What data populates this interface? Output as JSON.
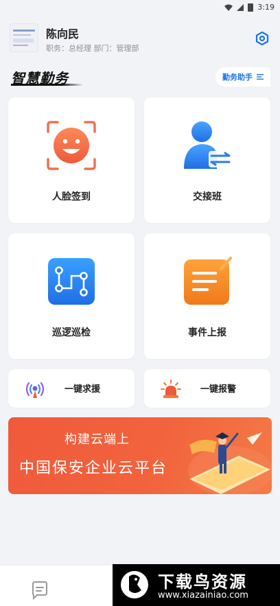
{
  "status_bar": {
    "time": "3:19",
    "icons": [
      "wifi-icon",
      "signal-icon",
      "battery-icon"
    ]
  },
  "user": {
    "name": "陈向民",
    "subtitle": "职务：总经理 部门：管理部"
  },
  "section": {
    "title": "智慧勤务",
    "assistant_label": "勤务助手"
  },
  "features": [
    {
      "label": "人脸签到",
      "icon": "face-icon"
    },
    {
      "label": "交接班",
      "icon": "handover-icon"
    },
    {
      "label": "巡逻巡检",
      "icon": "patrol-route-icon"
    },
    {
      "label": "事件上报",
      "icon": "report-icon"
    }
  ],
  "quick_actions": [
    {
      "label": "一键求援",
      "icon": "broadcast-icon"
    },
    {
      "label": "一键报警",
      "icon": "alarm-light-icon"
    }
  ],
  "banner": {
    "line1": "构建云端上",
    "line2": "中国保安企业云平台"
  },
  "watermark": {
    "title": "下载鸟资源",
    "url": "www.xiazainiao.com"
  },
  "colors": {
    "accent": "#1a73e8",
    "orange": "#f07a3c",
    "banner": "#ef5a3b",
    "blue_icon": "#2b7bf0"
  }
}
